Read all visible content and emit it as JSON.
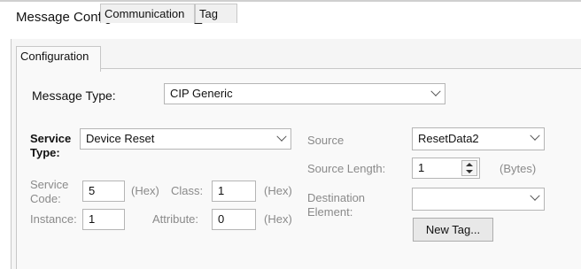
{
  "window": {
    "title": "Message Configuration - MSG_4"
  },
  "tabs": [
    {
      "label": "Configuration",
      "active": true
    },
    {
      "label": "Communication",
      "active": false
    },
    {
      "label": "Tag",
      "active": false
    }
  ],
  "message_type": {
    "label": "Message Type:",
    "value": "CIP Generic"
  },
  "service_type": {
    "label": "Service Type:",
    "value": "Device Reset"
  },
  "service_code": {
    "label": "Service Code:",
    "value": "5",
    "unit": "(Hex)"
  },
  "class": {
    "label": "Class:",
    "value": "1",
    "unit": "(Hex)"
  },
  "instance": {
    "label": "Instance:",
    "value": "1"
  },
  "attribute": {
    "label": "Attribute:",
    "value": "0",
    "unit": "(Hex)"
  },
  "source": {
    "label": "Source",
    "value": "ResetData2"
  },
  "source_length": {
    "label": "Source Length:",
    "value": "1",
    "unit": "(Bytes)"
  },
  "destination": {
    "label": "Destination Element:",
    "value": ""
  },
  "new_tag_button": {
    "label": "New Tag..."
  }
}
